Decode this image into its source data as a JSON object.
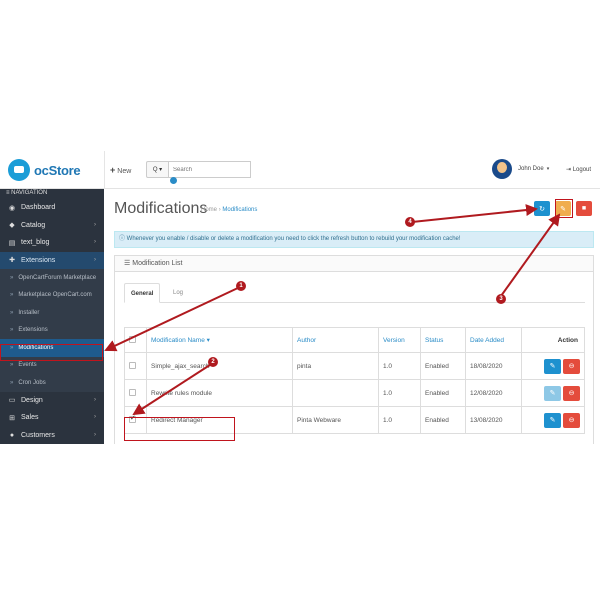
{
  "header": {
    "logo_text": "ocStore",
    "new_label": "New",
    "search": {
      "dropdown_label": "Q ▾",
      "placeholder": "Search"
    },
    "user_name": "John Doe",
    "logout_label": "Logout"
  },
  "sidebar": {
    "heading": "≡ NAVIGATION",
    "items": [
      {
        "label": "Dashboard",
        "icon": "dashboard-icon",
        "chevron": false
      },
      {
        "label": "Catalog",
        "icon": "tag-icon",
        "chevron": true
      },
      {
        "label": "text_blog",
        "icon": "book-icon",
        "chevron": true
      },
      {
        "label": "Extensions",
        "icon": "puzzle-icon",
        "chevron": true,
        "active": true
      }
    ],
    "sub_items": [
      {
        "label": "OpenCartForum Marketplace"
      },
      {
        "label": "Marketplace OpenCart.com"
      },
      {
        "label": "Installer"
      },
      {
        "label": "Extensions"
      },
      {
        "label": "Modifications",
        "active": true
      },
      {
        "label": "Events"
      },
      {
        "label": "Cron Jobs"
      }
    ],
    "bottom_items": [
      {
        "label": "Design",
        "icon": "monitor-icon",
        "chevron": true
      },
      {
        "label": "Sales",
        "icon": "cart-icon",
        "chevron": true
      },
      {
        "label": "Customers",
        "icon": "user-icon",
        "chevron": true
      }
    ]
  },
  "page": {
    "title": "Modifications",
    "breadcrumb": [
      "Home",
      "Modifications"
    ],
    "breadcrumb_sep": "›",
    "toolbar": {
      "refresh_color": "#1e91cf",
      "clear_color": "#f0ad4e",
      "delete_color": "#e44c3c"
    },
    "alert": "Whenever you enable / disable or delete a modification you need to click the refresh button to rebuild your modification cache!",
    "panel_title": "Modification List",
    "tabs": [
      "General",
      "Log"
    ],
    "table": {
      "headers": [
        "Modification Name ▾",
        "Author",
        "Version",
        "Status",
        "Date Added",
        "Action"
      ],
      "rows": [
        {
          "name": "Simple_ajax_search",
          "author": "pinta",
          "version": "1.0",
          "status": "Enabled",
          "date": "18/08/2020",
          "checked": false
        },
        {
          "name": "Rewrite rules module",
          "author": "",
          "version": "1.0",
          "status": "Enabled",
          "date": "12/08/2020",
          "checked": false
        },
        {
          "name": "Redirect Manager",
          "author": "Pinta Webware",
          "version": "1.0",
          "status": "Enabled",
          "date": "13/08/2020",
          "checked": true
        }
      ]
    }
  },
  "annotations": {
    "color": "#b01a1f",
    "badges": [
      "1",
      "2",
      "3",
      "4"
    ]
  }
}
